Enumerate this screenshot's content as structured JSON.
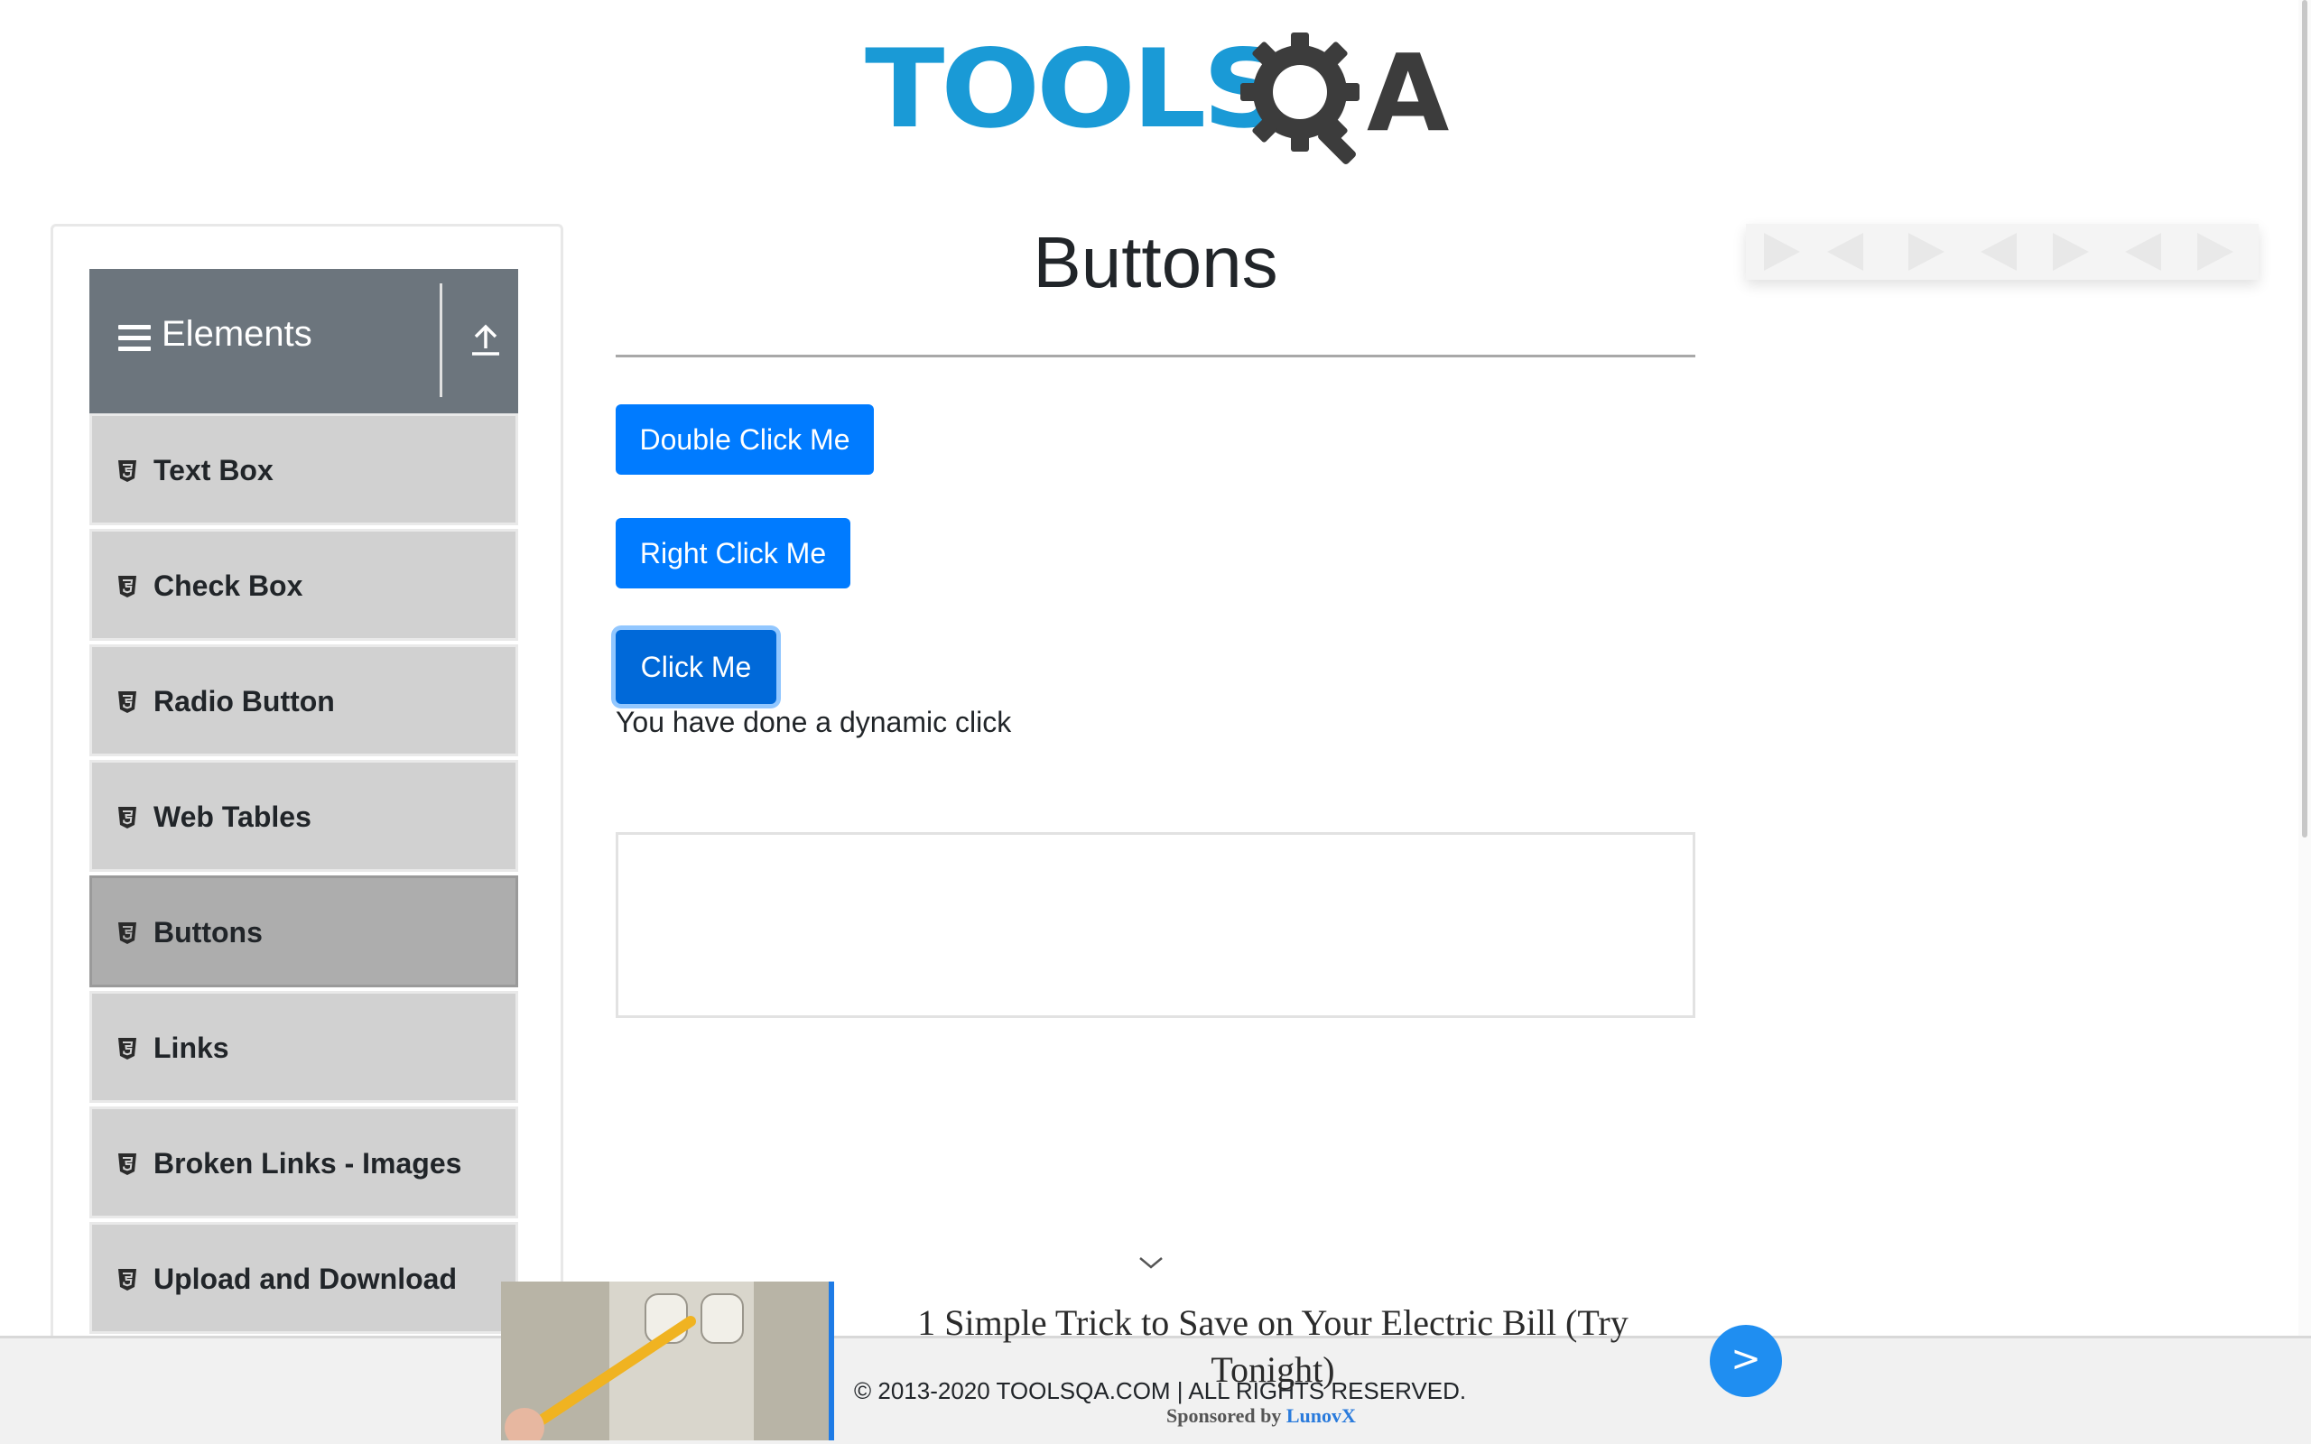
{
  "header": {
    "logo_text": "TOOLS",
    "logo_suffix": "A",
    "logo_alt": "TOOLSQA"
  },
  "sidebar": {
    "group_title": "Elements",
    "items": [
      {
        "label": "Text Box",
        "active": false
      },
      {
        "label": "Check Box",
        "active": false
      },
      {
        "label": "Radio Button",
        "active": false
      },
      {
        "label": "Web Tables",
        "active": false
      },
      {
        "label": "Buttons",
        "active": true
      },
      {
        "label": "Links",
        "active": false
      },
      {
        "label": "Broken Links - Images",
        "active": false
      },
      {
        "label": "Upload and Download",
        "active": false
      }
    ]
  },
  "main": {
    "title": "Buttons",
    "double_click_label": "Double Click Me",
    "right_click_label": "Right Click Me",
    "click_label": "Click Me",
    "dynamic_click_message": "You have done a dynamic click"
  },
  "ad": {
    "headline": "1 Simple Trick to Save on Your Electric Bill (Try Tonight)",
    "sponsored_prefix": "Sponsored by",
    "sponsor": "LunovX",
    "go_label": ">"
  },
  "footer": {
    "copyright": "© 2013-2020 TOOLSQA.COM | ALL RIGHTS RESERVED."
  },
  "colors": {
    "primary": "#007bff",
    "logo_blue": "#1a9ad6",
    "sidebar_header": "#6c757d",
    "menu_item": "#d1d1d1",
    "menu_item_active": "#adadad"
  }
}
